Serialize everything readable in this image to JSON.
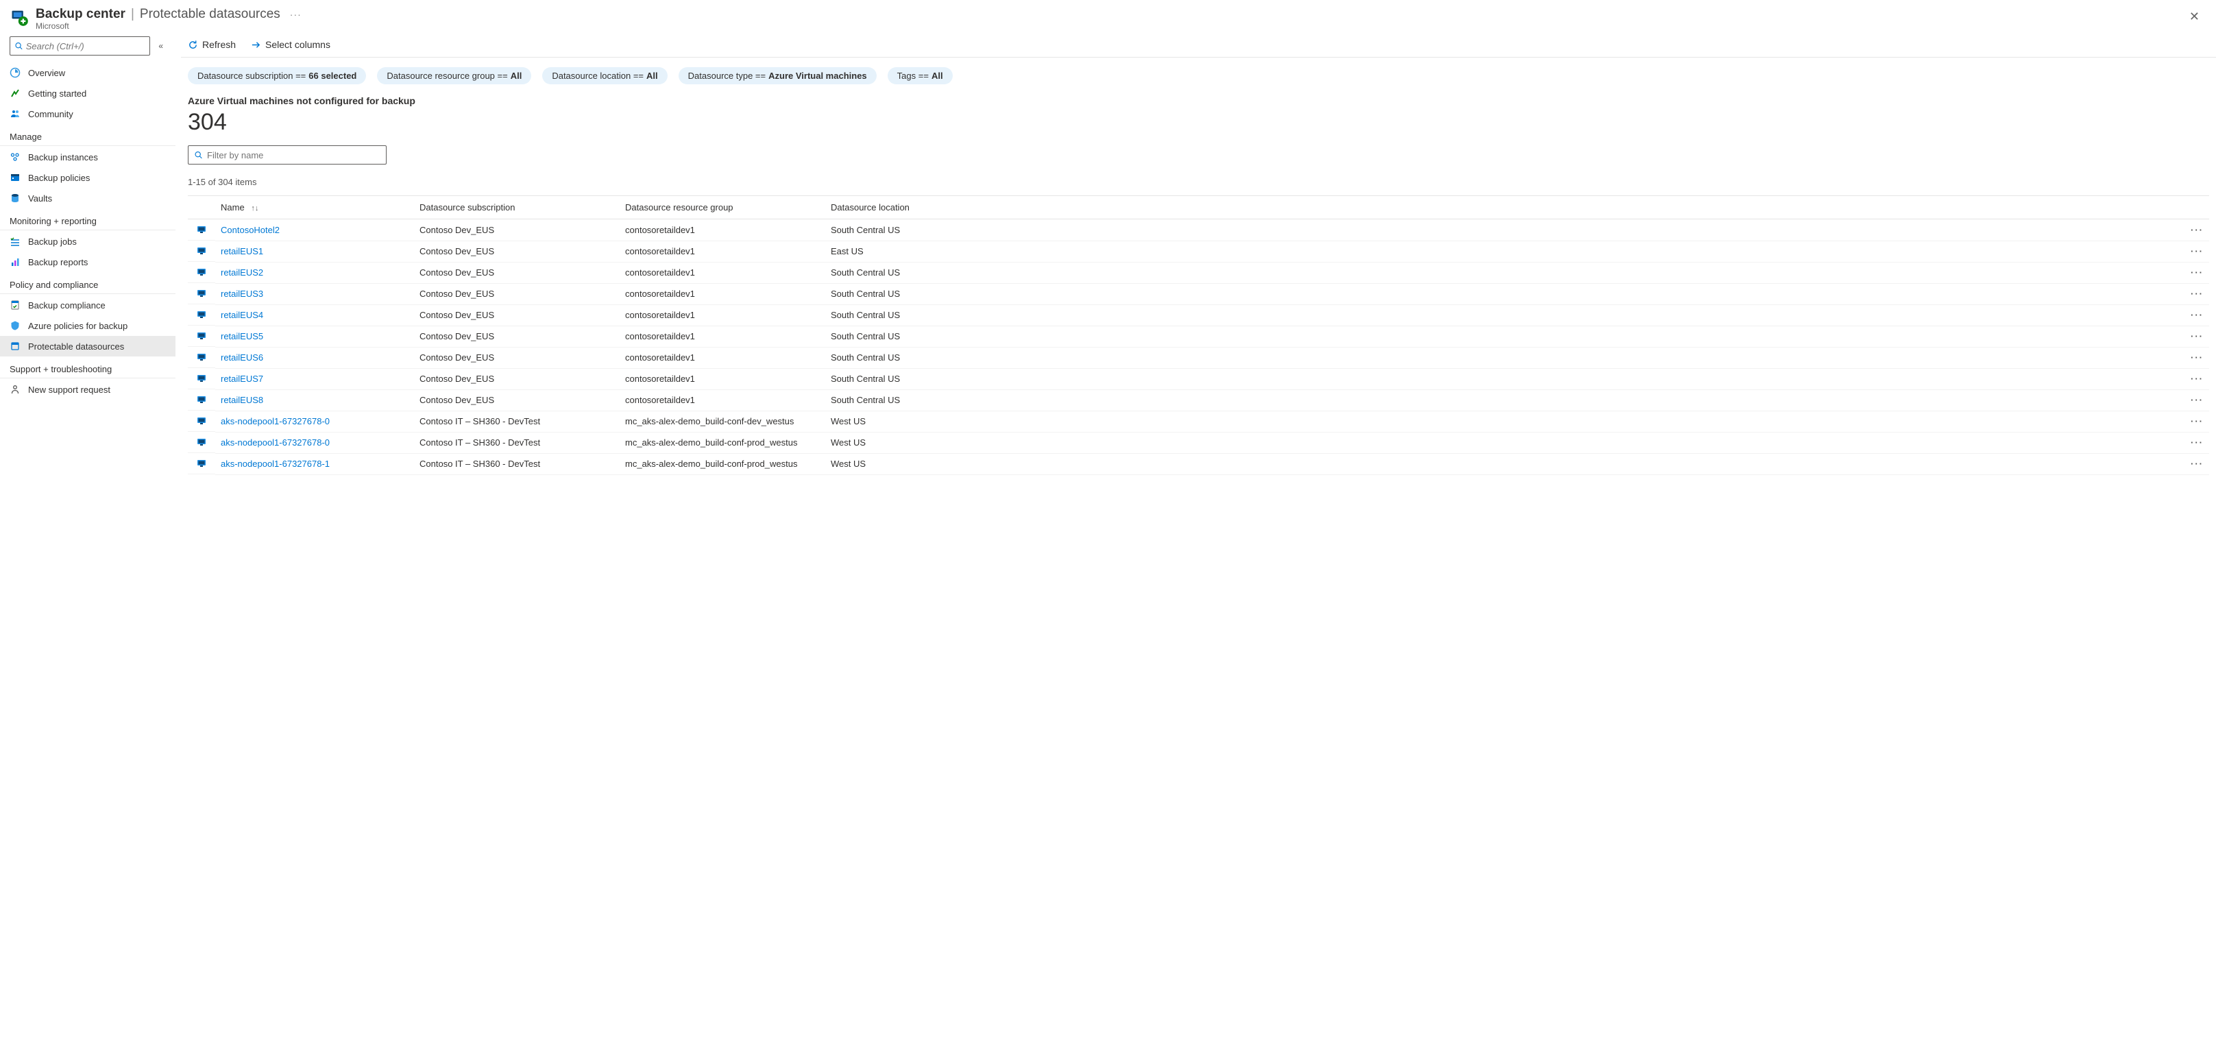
{
  "header": {
    "title_main": "Backup center",
    "title_sep": "|",
    "title_page": "Protectable datasources",
    "subtitle": "Microsoft"
  },
  "search": {
    "placeholder": "Search (Ctrl+/)"
  },
  "nav": {
    "top": [
      {
        "label": "Overview",
        "icon": "#icon-overview"
      },
      {
        "label": "Getting started",
        "icon": "#icon-getting-started"
      },
      {
        "label": "Community",
        "icon": "#icon-community"
      }
    ],
    "sections": [
      {
        "title": "Manage",
        "items": [
          {
            "label": "Backup instances",
            "icon": "#icon-instances"
          },
          {
            "label": "Backup policies",
            "icon": "#icon-policies"
          },
          {
            "label": "Vaults",
            "icon": "#icon-vaults"
          }
        ]
      },
      {
        "title": "Monitoring + reporting",
        "items": [
          {
            "label": "Backup jobs",
            "icon": "#icon-jobs"
          },
          {
            "label": "Backup reports",
            "icon": "#icon-reports"
          }
        ]
      },
      {
        "title": "Policy and compliance",
        "items": [
          {
            "label": "Backup compliance",
            "icon": "#icon-compliance"
          },
          {
            "label": "Azure policies for backup",
            "icon": "#icon-azure-policy"
          },
          {
            "label": "Protectable datasources",
            "icon": "#icon-protectable",
            "selected": true
          }
        ]
      },
      {
        "title": "Support + troubleshooting",
        "items": [
          {
            "label": "New support request",
            "icon": "#icon-support"
          }
        ]
      }
    ]
  },
  "toolbar": {
    "refresh": "Refresh",
    "select_columns": "Select columns"
  },
  "filters": [
    {
      "label": "Datasource subscription ==",
      "value": "66 selected"
    },
    {
      "label": "Datasource resource group ==",
      "value": "All"
    },
    {
      "label": "Datasource location ==",
      "value": "All"
    },
    {
      "label": "Datasource type ==",
      "value": "Azure Virtual machines"
    },
    {
      "label": "Tags ==",
      "value": "All"
    }
  ],
  "summary": {
    "label": "Azure Virtual machines not configured for backup",
    "count": "304"
  },
  "filter_input": {
    "placeholder": "Filter by name"
  },
  "range_text": "1-15 of 304 items",
  "columns": {
    "name": "Name",
    "subscription": "Datasource subscription",
    "resource_group": "Datasource resource group",
    "location": "Datasource location"
  },
  "rows": [
    {
      "name": "ContosoHotel2",
      "subscription": "Contoso Dev_EUS",
      "resource_group": "contosoretaildev1",
      "location": "South Central US"
    },
    {
      "name": "retailEUS1",
      "subscription": "Contoso Dev_EUS",
      "resource_group": "contosoretaildev1",
      "location": "East US"
    },
    {
      "name": "retailEUS2",
      "subscription": "Contoso Dev_EUS",
      "resource_group": "contosoretaildev1",
      "location": "South Central US"
    },
    {
      "name": "retailEUS3",
      "subscription": "Contoso Dev_EUS",
      "resource_group": "contosoretaildev1",
      "location": "South Central US"
    },
    {
      "name": "retailEUS4",
      "subscription": "Contoso Dev_EUS",
      "resource_group": "contosoretaildev1",
      "location": "South Central US"
    },
    {
      "name": "retailEUS5",
      "subscription": "Contoso Dev_EUS",
      "resource_group": "contosoretaildev1",
      "location": "South Central US"
    },
    {
      "name": "retailEUS6",
      "subscription": "Contoso Dev_EUS",
      "resource_group": "contosoretaildev1",
      "location": "South Central US"
    },
    {
      "name": "retailEUS7",
      "subscription": "Contoso Dev_EUS",
      "resource_group": "contosoretaildev1",
      "location": "South Central US"
    },
    {
      "name": "retailEUS8",
      "subscription": "Contoso Dev_EUS",
      "resource_group": "contosoretaildev1",
      "location": "South Central US"
    },
    {
      "name": "aks-nodepool1-67327678-0",
      "subscription": "Contoso IT – SH360 - DevTest",
      "resource_group": "mc_aks-alex-demo_build-conf-dev_westus",
      "location": "West US"
    },
    {
      "name": "aks-nodepool1-67327678-0",
      "subscription": "Contoso IT – SH360 - DevTest",
      "resource_group": "mc_aks-alex-demo_build-conf-prod_westus",
      "location": "West US"
    },
    {
      "name": "aks-nodepool1-67327678-1",
      "subscription": "Contoso IT – SH360 - DevTest",
      "resource_group": "mc_aks-alex-demo_build-conf-prod_westus",
      "location": "West US"
    }
  ]
}
